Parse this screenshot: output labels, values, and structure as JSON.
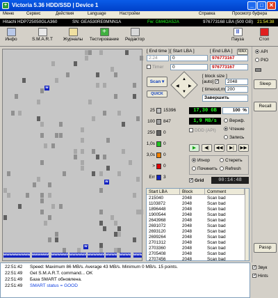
{
  "window": {
    "title": "Victoria 5.36 HDD/SSD | Device 1",
    "min": "_",
    "max": "□",
    "close": "✕"
  },
  "menu": [
    "Меню",
    "Сервис",
    "Действия",
    "Language",
    "Настройки",
    "Справка",
    "Просмотр буфера"
  ],
  "infobar": {
    "model": "Hitachi HDP725050GLA360",
    "serial": "SN: GEA530RE0MNN1A",
    "fw": "Fw: GM4OA52A",
    "size": "976773168 LBA (500 GB)",
    "time": "21:54:38"
  },
  "toolbar": {
    "info": "Инфо",
    "smart": "S.M.A.R.T",
    "journals": "Журналы",
    "testing": "Тестирование",
    "editor": "Редактор",
    "pause": "Пауза",
    "stop": "Стоп"
  },
  "controls": {
    "end_time_label": "[ End time ]",
    "end_time_value": "2:24",
    "start_lba_label": "[ Start LBA ]",
    "start_lba_value": "0",
    "end_lba_label": "[ End LBA ]",
    "end_lba_max": "MAX",
    "end_lba_value": "976773167",
    "timer_label": "Timer",
    "timer_value": "0",
    "second_lba": "976773167",
    "scan": "Scan",
    "quick": "QUICK",
    "block_size_label": "[ block size ]",
    "auto": "auto",
    "block_size": "2048",
    "timeout_label": "[ timeout,ms ]",
    "timeout": "200",
    "finish_action": "Завершить"
  },
  "timing": [
    {
      "ms": "25",
      "count": "15396",
      "color": "#c0c0c0"
    },
    {
      "ms": "100",
      "count": "847",
      "color": "#a0a0a0"
    },
    {
      "ms": "250",
      "count": "0",
      "color": "#606060"
    },
    {
      "ms": "1,0s",
      "count": "0",
      "color": "#20c020"
    },
    {
      "ms": "3,0s",
      "count": "0",
      "color": "#f08000"
    },
    {
      "ms": ">",
      "count": "0",
      "color": "#e00000"
    },
    {
      "ms": "Err",
      "count": "3",
      "color": "#1020c0"
    }
  ],
  "stats": {
    "scanned": "17,30 GB",
    "percent": "100",
    "percent_unit": "%",
    "speed": "1,9 MB/s",
    "ddd": "DDD (API)",
    "verify": "Вериф.",
    "read": "Чтение",
    "write": "Запись",
    "ignore": "Игнор",
    "erase": "Стереть",
    "remap": "Починить",
    "refresh": "Refresh",
    "grid": "Grid",
    "elapsed": "00:14:48"
  },
  "sidebar": {
    "api": "API",
    "pio": "PIO",
    "sleep": "Sleep",
    "recall": "Recall",
    "passp": "Passp",
    "sound": "Звук",
    "hints": "Hints"
  },
  "table": {
    "headers": [
      "Start LBA",
      "Block",
      "Comment"
    ],
    "rows": [
      [
        "215040",
        "2048",
        "Scan bad"
      ],
      [
        "1103872",
        "2048",
        "Scan bad"
      ],
      [
        "1896448",
        "2048",
        "Scan bad"
      ],
      [
        "1900544",
        "2048",
        "Scan bad"
      ],
      [
        "2643968",
        "2048",
        "Scan bad"
      ],
      [
        "2691072",
        "2048",
        "Scan bad"
      ],
      [
        "2693120",
        "2048",
        "Scan bad"
      ],
      [
        "2699264",
        "2048",
        "Scan bad"
      ],
      [
        "2701312",
        "2048",
        "Scan bad"
      ],
      [
        "2703360",
        "2048",
        "Scan bad"
      ],
      [
        "2705408",
        "2048",
        "Scan bad"
      ],
      [
        "2707456",
        "2048",
        "Scan bad"
      ]
    ]
  },
  "log": [
    {
      "time": "22:51:42",
      "text": "Speed: Maximum 86 MB/s. Average 43 MB/s. Minimum 0 MB/s. 15 points.",
      "color": "#000000"
    },
    {
      "time": "22:51:49",
      "text": "Get S.M.A.R.T. command... OK",
      "color": "#000000"
    },
    {
      "time": "22:51:49",
      "text": "База SMART обновлена.",
      "color": "#000000"
    },
    {
      "time": "22:51:49",
      "text": "SMART status = GOOD",
      "color": "#1040e0"
    }
  ],
  "grid_marker": "w",
  "grid_bottom_markers": "wwwwwwwww"
}
